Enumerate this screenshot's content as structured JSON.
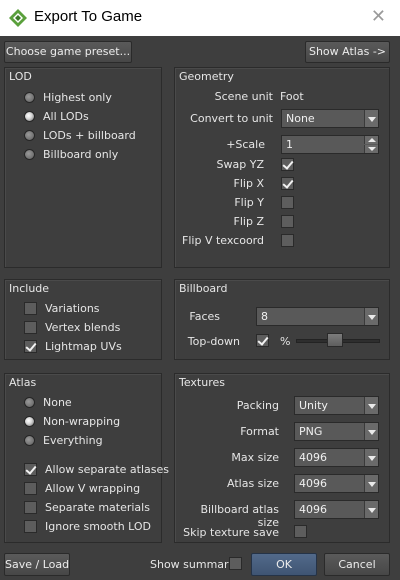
{
  "window": {
    "title": "Export To Game"
  },
  "top_buttons": {
    "preset": "Choose game preset...",
    "atlas": "Show Atlas ->"
  },
  "lod": {
    "title": "LOD",
    "options": [
      "Highest only",
      "All LODs",
      "LODs + billboard",
      "Billboard only"
    ],
    "selected": "All LODs"
  },
  "geometry": {
    "title": "Geometry",
    "scene_unit_label": "Scene unit",
    "scene_unit_value": "Foot",
    "convert_label": "Convert to unit",
    "convert_value": "None",
    "scale_label": "+Scale",
    "scale_value": "1",
    "swap_yz_label": "Swap YZ",
    "swap_yz": true,
    "flip_x_label": "Flip X",
    "flip_x": true,
    "flip_y_label": "Flip Y",
    "flip_y": false,
    "flip_z_label": "Flip Z",
    "flip_z": false,
    "flip_v_label": "Flip V texcoord",
    "flip_v": false
  },
  "include": {
    "title": "Include",
    "variations": "Variations",
    "variations_on": false,
    "vertex_blends": "Vertex blends",
    "vertex_blends_on": false,
    "lightmap_uvs": "Lightmap UVs",
    "lightmap_uvs_on": true
  },
  "billboard": {
    "title": "Billboard",
    "faces_label": "Faces",
    "faces_value": "8",
    "topdown_label": "Top-down",
    "topdown_on": true,
    "percent": "%",
    "topdown_slider_fraction": 0.45
  },
  "atlas": {
    "title": "Atlas",
    "options": [
      "None",
      "Non-wrapping",
      "Everything"
    ],
    "selected": "Non-wrapping",
    "allow_separate": "Allow separate atlases",
    "allow_separate_on": true,
    "allow_v_wrap": "Allow V wrapping",
    "allow_v_wrap_on": false,
    "separate_materials": "Separate materials",
    "separate_materials_on": false,
    "ignore_smooth": "Ignore smooth LOD",
    "ignore_smooth_on": false
  },
  "textures": {
    "title": "Textures",
    "packing_label": "Packing",
    "packing_value": "Unity",
    "format_label": "Format",
    "format_value": "PNG",
    "max_size_label": "Max size",
    "max_size_value": "4096",
    "atlas_size_label": "Atlas size",
    "atlas_size_value": "4096",
    "bb_atlas_size_label": "Billboard atlas size",
    "bb_atlas_size_value": "4096",
    "skip_save_label": "Skip texture save",
    "skip_save_on": false
  },
  "footer": {
    "save_load": "Save / Load",
    "show_summary": "Show summary",
    "show_summary_on": false,
    "ok": "OK",
    "cancel": "Cancel"
  }
}
